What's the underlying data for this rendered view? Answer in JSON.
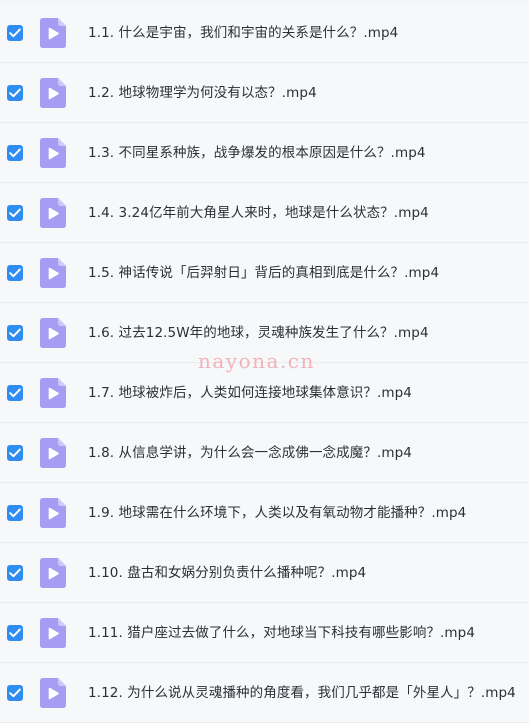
{
  "files": [
    {
      "name": "1.1. 什么是宇宙，我们和宇宙的关系是什么？.mp4",
      "checked": true
    },
    {
      "name": "1.2. 地球物理学为何没有以态？.mp4",
      "checked": true
    },
    {
      "name": "1.3. 不同星系种族，战争爆发的根本原因是什么？.mp4",
      "checked": true
    },
    {
      "name": "1.4. 3.24亿年前大角星人来时，地球是什么状态？.mp4",
      "checked": true
    },
    {
      "name": "1.5. 神话传说「后羿射日」背后的真相到底是什么？.mp4",
      "checked": true
    },
    {
      "name": "1.6. 过去12.5W年的地球，灵魂种族发生了什么？.mp4",
      "checked": true
    },
    {
      "name": "1.7. 地球被炸后，人类如何连接地球集体意识？.mp4",
      "checked": true
    },
    {
      "name": "1.8. 从信息学讲，为什么会一念成佛一念成魔？.mp4",
      "checked": true
    },
    {
      "name": "1.9. 地球需在什么环境下，人类以及有氧动物才能播种？.mp4",
      "checked": true
    },
    {
      "name": "1.10. 盘古和女娲分别负责什么播种呢？.mp4",
      "checked": true
    },
    {
      "name": "1.11. 猎户座过去做了什么，对地球当下科技有哪些影响？.mp4",
      "checked": true
    },
    {
      "name": "1.12. 为什么说从灵魂播种的角度看，我们几乎都是「外星人」？.mp4",
      "checked": true
    }
  ],
  "watermark": "nayona.cn",
  "colors": {
    "checkbox": "#2f8cf0",
    "video_icon": "#a79cf4",
    "video_icon_fold": "#cfc8fa"
  },
  "icons": {
    "checkbox": "checkmark-icon",
    "file": "video-file-icon"
  }
}
